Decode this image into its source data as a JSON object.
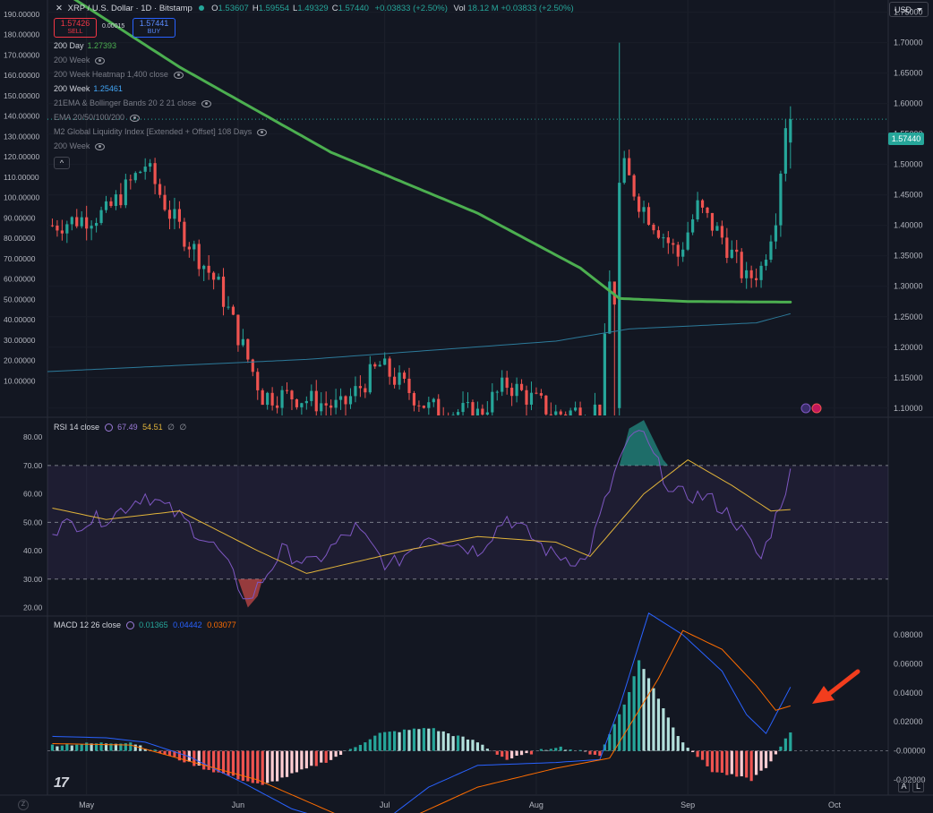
{
  "header": {
    "close_glyph": "✕",
    "symbol": "XRP / U.S. Dollar · 1D · Bitstamp",
    "ohlc": [
      {
        "k": "O",
        "v": "1.53607"
      },
      {
        "k": "H",
        "v": "1.59554"
      },
      {
        "k": "L",
        "v": "1.49329"
      },
      {
        "k": "C",
        "v": "1.57440"
      }
    ],
    "change": "+0.03833 (+2.50%)",
    "vol_label": "Vol",
    "vol_value": "18.12 M",
    "vol_change": "+0.03833 (+2.50%)"
  },
  "trade": {
    "sell_price": "1.57426",
    "sell_label": "SELL",
    "spread": "0.00015",
    "buy_price": "1.57441",
    "buy_label": "BUY"
  },
  "currency": "USD",
  "collapse_glyph": "^",
  "last_price": "1.57440",
  "indicators": [
    {
      "name": "200 Day",
      "value": "1.27393",
      "color": "#4caf50",
      "eye": false
    },
    {
      "name": "200 Week",
      "value": "",
      "color": "",
      "eye": true
    },
    {
      "name": "200 Week Heatmap 1,400 close",
      "value": "",
      "color": "",
      "eye": true
    },
    {
      "name": "200 Week",
      "value": "1.25461",
      "color": "#42a5f5",
      "eye": false,
      "bright": true
    },
    {
      "name": "21EMA & Bollinger Bands 20 2 21 close",
      "value": "",
      "color": "",
      "eye": true
    },
    {
      "name": "EMA 20/50/100/200",
      "value": "",
      "color": "",
      "eye": true
    },
    {
      "name": "M2 Global Liquidity Index [Extended + Offset] 108 Days",
      "value": "",
      "color": "",
      "eye": true
    },
    {
      "name": "200 Week",
      "value": "",
      "color": "",
      "eye": true
    }
  ],
  "rsi": {
    "label": "RSI 14 close",
    "v1": "67.49",
    "v2": "54.51",
    "v3": "∅",
    "v4": "∅",
    "ticks": [
      "80.00",
      "70.00",
      "60.00",
      "50.00",
      "40.00",
      "30.00",
      "20.00"
    ]
  },
  "macd": {
    "label": "MACD 12 26 close",
    "v1": "0.01365",
    "v2": "0.04442",
    "v3": "0.03077",
    "ticks": [
      "0.08000",
      "0.06000",
      "0.04000",
      "0.02000",
      "-0.00000",
      "-0.02000"
    ]
  },
  "left_ticks": [
    "190.00000",
    "180.00000",
    "170.00000",
    "160.00000",
    "150.00000",
    "140.00000",
    "130.00000",
    "120.00000",
    "110.00000",
    "100.00000",
    "90.00000",
    "80.00000",
    "70.00000",
    "60.00000",
    "50.00000",
    "40.00000",
    "30.00000",
    "20.00000",
    "10.00000"
  ],
  "right_ticks": [
    "1.75000",
    "1.70000",
    "1.65000",
    "1.60000",
    "1.55000",
    "1.50000",
    "1.45000",
    "1.40000",
    "1.35000",
    "1.30000",
    "1.25000",
    "1.20000",
    "1.15000",
    "1.10000"
  ],
  "x_ticks": [
    "May",
    "Jun",
    "Jul",
    "Aug",
    "Sep",
    "Oct"
  ],
  "scale_buttons": [
    "A",
    "L"
  ],
  "z_label": "Z",
  "colors": {
    "up": "#26a69a",
    "down": "#ef5350",
    "ma200d": "#4caf50",
    "ma200w": "#2c7a9a",
    "rsi": "#7e57c2",
    "rsi_ma": "#e0b33a",
    "macd": "#2962ff",
    "signal": "#ff6d00",
    "arrow": "#f23d1d"
  },
  "chart_data": {
    "type": "candlestick",
    "x_range": [
      "2025-04-23",
      "2025-10-12"
    ],
    "y_right_range": [
      1.085,
      1.77
    ],
    "y_left_range": [
      0,
      195
    ],
    "price_samples": [
      [
        "2025-04-24",
        1.4
      ],
      [
        "2025-05-05",
        1.42
      ],
      [
        "2025-05-13",
        1.5
      ],
      [
        "2025-05-18",
        1.42
      ],
      [
        "2025-05-28",
        1.3
      ],
      [
        "2025-06-01",
        1.22
      ],
      [
        "2025-06-06",
        1.12
      ],
      [
        "2025-06-12",
        1.12
      ],
      [
        "2025-06-22",
        1.1
      ],
      [
        "2025-06-30",
        1.17
      ],
      [
        "2025-07-10",
        1.1
      ],
      [
        "2025-07-20",
        1.09
      ],
      [
        "2025-07-26",
        1.14
      ],
      [
        "2025-08-05",
        1.09
      ],
      [
        "2025-08-14",
        1.1
      ],
      [
        "2025-08-18",
        1.51
      ],
      [
        "2025-08-22",
        1.44
      ],
      [
        "2025-08-30",
        1.35
      ],
      [
        "2025-09-03",
        1.43
      ],
      [
        "2025-09-08",
        1.38
      ],
      [
        "2025-09-13",
        1.31
      ],
      [
        "2025-09-16",
        1.33
      ],
      [
        "2025-09-19",
        1.42
      ],
      [
        "2025-09-21",
        1.57
      ]
    ],
    "ma_200day": [
      [
        "2025-04-23",
        1.8
      ],
      [
        "2025-05-20",
        1.66
      ],
      [
        "2025-06-20",
        1.52
      ],
      [
        "2025-07-20",
        1.42
      ],
      [
        "2025-08-10",
        1.33
      ],
      [
        "2025-08-18",
        1.28
      ],
      [
        "2025-09-01",
        1.275
      ],
      [
        "2025-09-22",
        1.274
      ]
    ],
    "ma_200week": [
      [
        "2025-04-23",
        1.16
      ],
      [
        "2025-06-15",
        1.18
      ],
      [
        "2025-08-05",
        1.21
      ],
      [
        "2025-08-20",
        1.23
      ],
      [
        "2025-09-15",
        1.24
      ],
      [
        "2025-09-22",
        1.255
      ]
    ],
    "rsi": [
      [
        "2025-04-24",
        48
      ],
      [
        "2025-05-06",
        52
      ],
      [
        "2025-05-13",
        60
      ],
      [
        "2025-05-20",
        52
      ],
      [
        "2025-05-28",
        40
      ],
      [
        "2025-06-03",
        22
      ],
      [
        "2025-06-10",
        40
      ],
      [
        "2025-06-16",
        35
      ],
      [
        "2025-06-25",
        48
      ],
      [
        "2025-07-02",
        34
      ],
      [
        "2025-07-10",
        46
      ],
      [
        "2025-07-20",
        40
      ],
      [
        "2025-07-26",
        52
      ],
      [
        "2025-08-04",
        39
      ],
      [
        "2025-08-11",
        36
      ],
      [
        "2025-08-18",
        72
      ],
      [
        "2025-08-22",
        83
      ],
      [
        "2025-08-29",
        60
      ],
      [
        "2025-09-05",
        59
      ],
      [
        "2025-09-10",
        52
      ],
      [
        "2025-09-16",
        37
      ],
      [
        "2025-09-19",
        52
      ],
      [
        "2025-09-22",
        67
      ]
    ],
    "rsi_ma": [
      [
        "2025-04-24",
        55
      ],
      [
        "2025-05-05",
        51
      ],
      [
        "2025-05-20",
        54
      ],
      [
        "2025-06-05",
        40
      ],
      [
        "2025-06-15",
        32
      ],
      [
        "2025-07-05",
        40
      ],
      [
        "2025-07-20",
        45
      ],
      [
        "2025-08-05",
        43
      ],
      [
        "2025-08-12",
        38
      ],
      [
        "2025-08-23",
        60
      ],
      [
        "2025-09-01",
        72
      ],
      [
        "2025-09-10",
        63
      ],
      [
        "2025-09-18",
        54
      ],
      [
        "2025-09-22",
        54.5
      ]
    ],
    "macd": [
      [
        "2025-04-24",
        0.01
      ],
      [
        "2025-05-05",
        0.009
      ],
      [
        "2025-05-13",
        0.006
      ],
      [
        "2025-05-22",
        -0.004
      ],
      [
        "2025-06-02",
        -0.022
      ],
      [
        "2025-06-12",
        -0.04
      ],
      [
        "2025-06-22",
        -0.05
      ],
      [
        "2025-07-01",
        -0.048
      ],
      [
        "2025-07-10",
        -0.025
      ],
      [
        "2025-07-20",
        -0.01
      ],
      [
        "2025-08-05",
        -0.008
      ],
      [
        "2025-08-14",
        -0.006
      ],
      [
        "2025-08-18",
        0.03
      ],
      [
        "2025-08-24",
        0.095
      ],
      [
        "2025-08-31",
        0.08
      ],
      [
        "2025-09-08",
        0.055
      ],
      [
        "2025-09-13",
        0.025
      ],
      [
        "2025-09-17",
        0.012
      ],
      [
        "2025-09-22",
        0.044
      ]
    ],
    "signal": [
      [
        "2025-04-24",
        0.005
      ],
      [
        "2025-05-10",
        0.004
      ],
      [
        "2025-06-05",
        -0.02
      ],
      [
        "2025-06-22",
        -0.045
      ],
      [
        "2025-07-05",
        -0.048
      ],
      [
        "2025-07-20",
        -0.025
      ],
      [
        "2025-08-05",
        -0.012
      ],
      [
        "2025-08-16",
        -0.005
      ],
      [
        "2025-08-26",
        0.05
      ],
      [
        "2025-08-31",
        0.083
      ],
      [
        "2025-09-08",
        0.07
      ],
      [
        "2025-09-15",
        0.045
      ],
      [
        "2025-09-19",
        0.028
      ],
      [
        "2025-09-22",
        0.031
      ]
    ],
    "histogram_samples": [
      [
        "2025-04-24",
        0.004
      ],
      [
        "2025-05-10",
        0.006
      ],
      [
        "2025-05-25",
        -0.012
      ],
      [
        "2025-06-06",
        -0.024
      ],
      [
        "2025-06-20",
        -0.006
      ],
      [
        "2025-06-30",
        0.012
      ],
      [
        "2025-07-10",
        0.016
      ],
      [
        "2025-07-20",
        0.006
      ],
      [
        "2025-07-26",
        -0.006
      ],
      [
        "2025-08-05",
        0.003
      ],
      [
        "2025-08-14",
        -0.003
      ],
      [
        "2025-08-20",
        0.04
      ],
      [
        "2025-08-22",
        0.063
      ],
      [
        "2025-08-30",
        0.01
      ],
      [
        "2025-09-06",
        -0.014
      ],
      [
        "2025-09-14",
        -0.02
      ],
      [
        "2025-09-18",
        -0.008
      ],
      [
        "2025-09-22",
        0.013
      ]
    ]
  }
}
